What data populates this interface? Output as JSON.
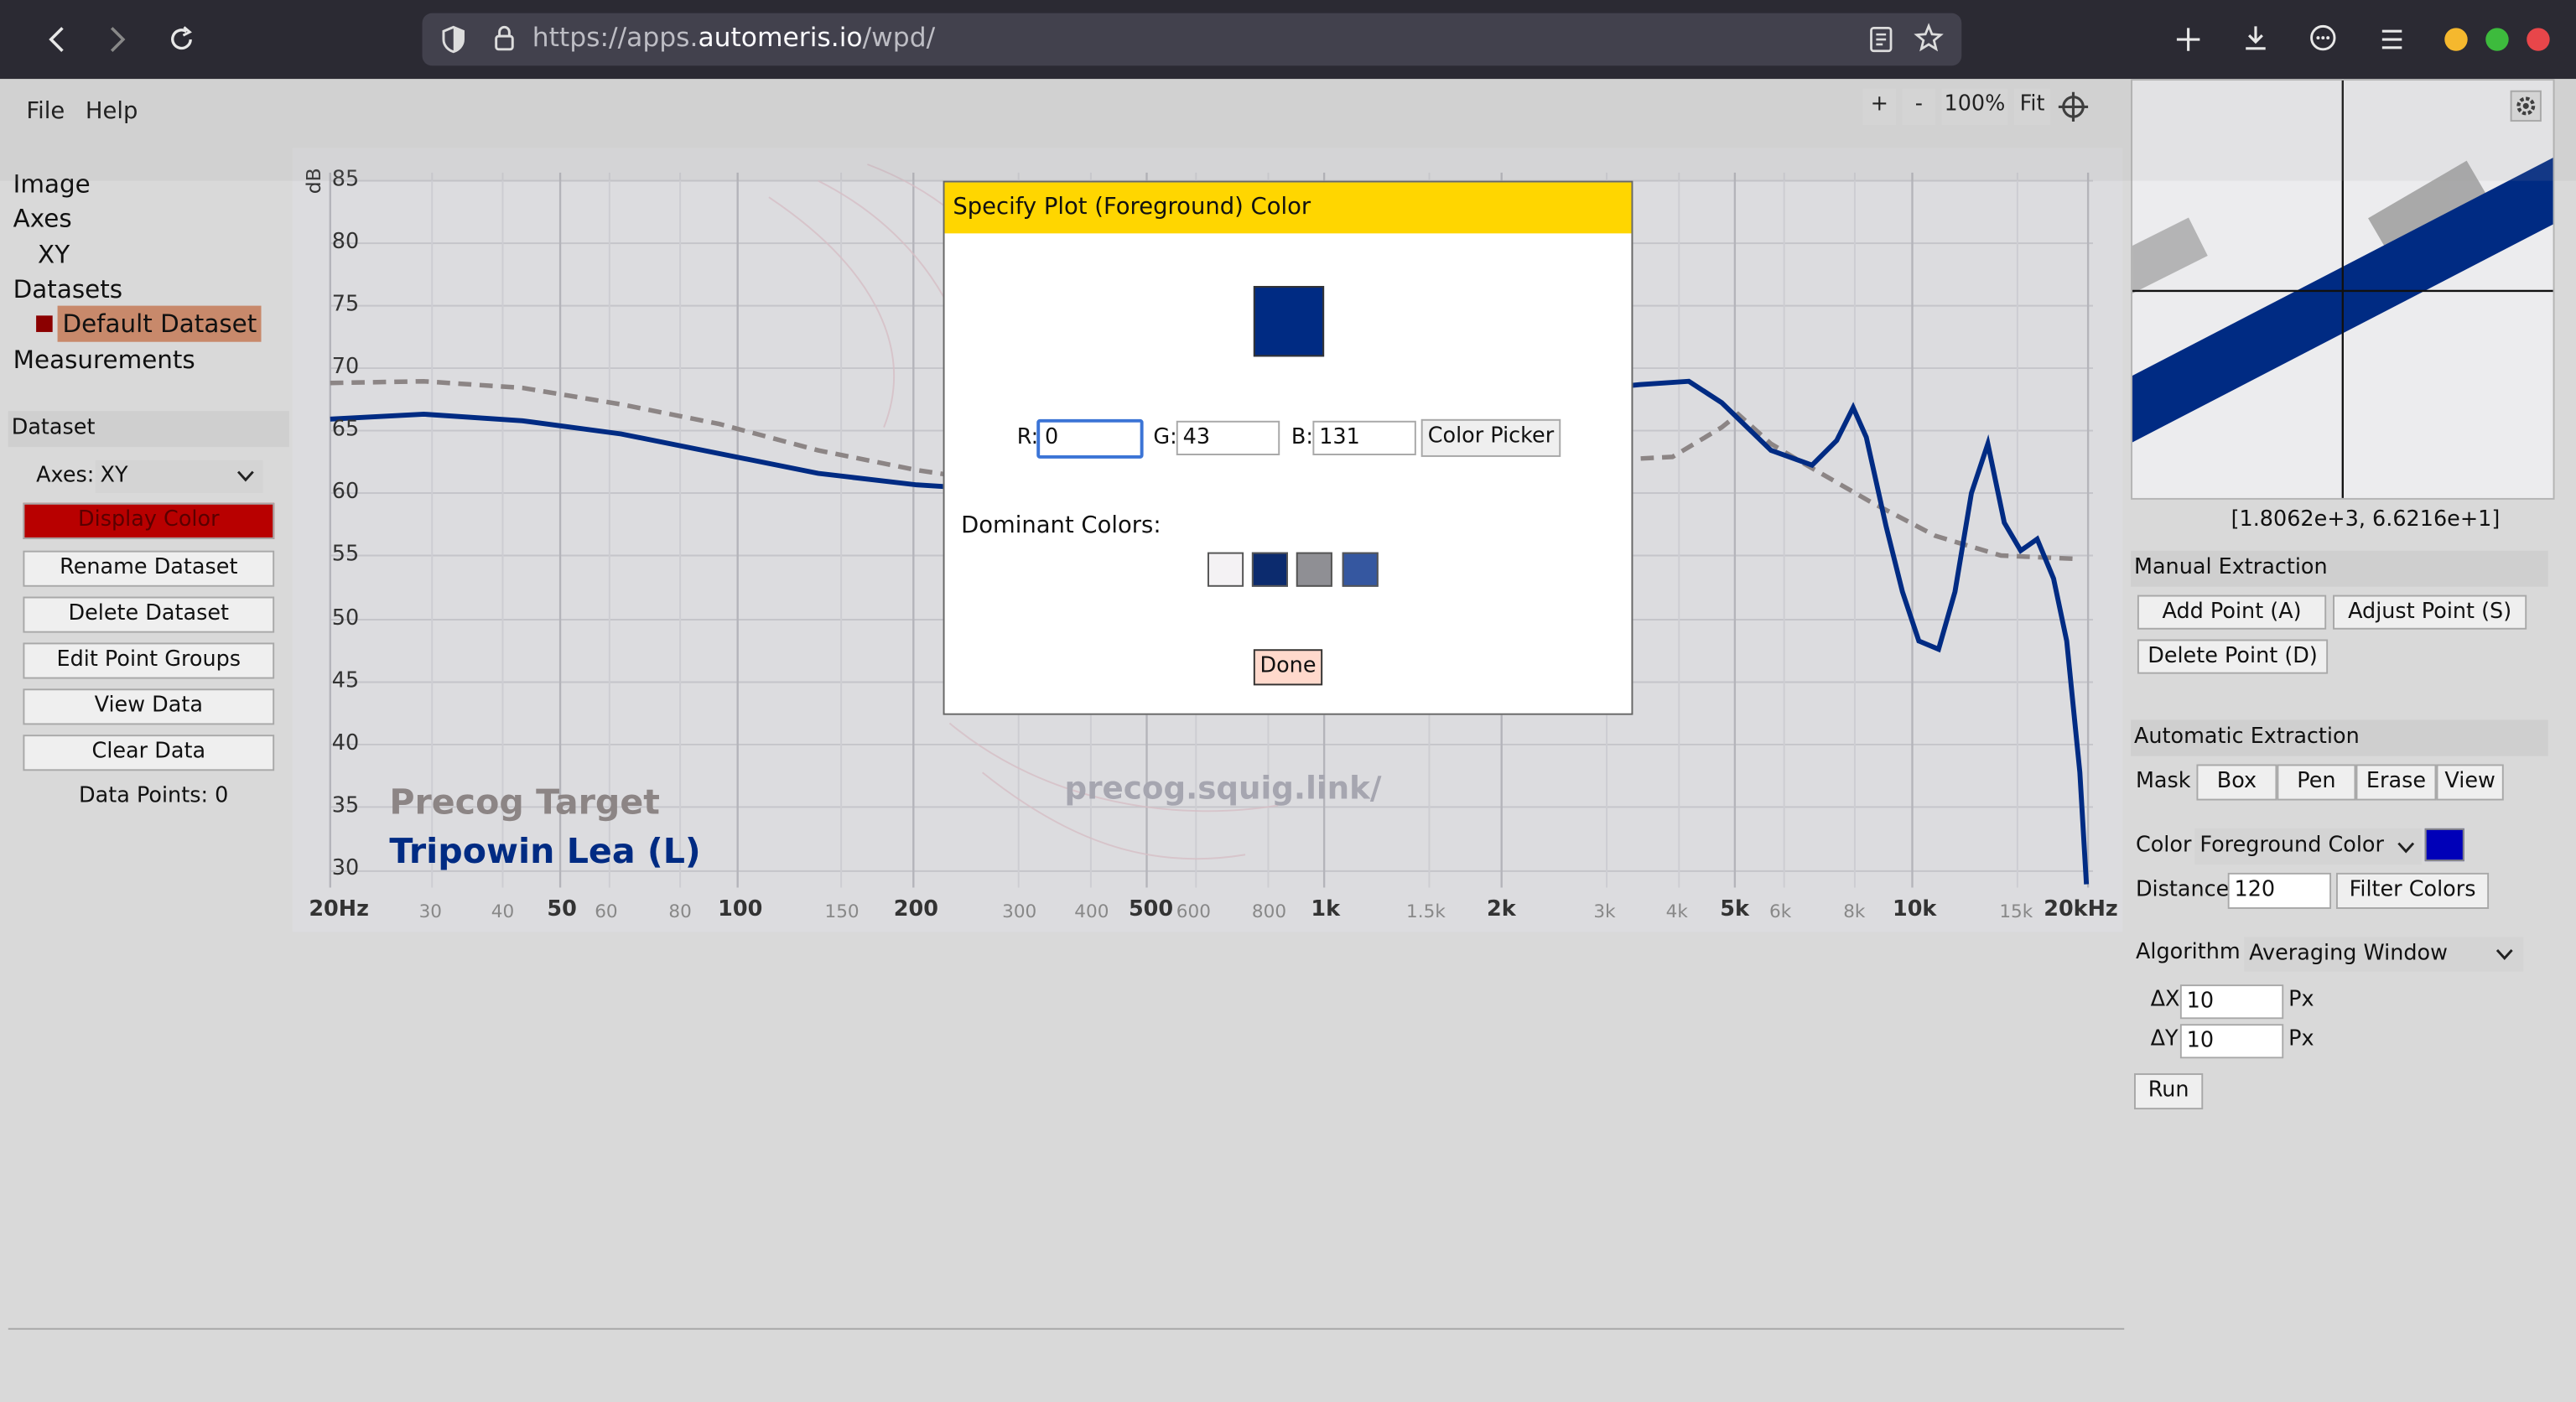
{
  "browser": {
    "url_prefix": "https://apps.",
    "url_domain": "automeris.io",
    "url_path": "/wpd/",
    "icons": [
      "back-arrow-icon",
      "forward-arrow-icon",
      "reload-icon",
      "shield-icon",
      "lock-icon",
      "reader-icon",
      "star-icon",
      "plus-icon",
      "download-icon",
      "extensions-icon",
      "menu-icon"
    ],
    "traffic_lights": [
      "#f5b82e",
      "#3dbb3d",
      "#e8464a"
    ]
  },
  "menu": {
    "file": "File",
    "help": "Help"
  },
  "zoom": {
    "plus": "+",
    "minus": "-",
    "level": "100%",
    "fit": "Fit"
  },
  "tree": {
    "image": "Image",
    "axes": "Axes",
    "xy": "XY",
    "datasets": "Datasets",
    "default_dataset": "Default Dataset",
    "measurements": "Measurements"
  },
  "dataset_panel": {
    "header": "Dataset",
    "axes_label": "Axes:",
    "axes_value": "XY",
    "display_color": "Display Color",
    "rename": "Rename Dataset",
    "delete": "Delete Dataset",
    "edit_groups": "Edit Point Groups",
    "view_data": "View Data",
    "clear_data": "Clear Data",
    "data_points": "Data Points: 0"
  },
  "plot": {
    "y_unit": "dB",
    "y_ticks": [
      "85",
      "80",
      "75",
      "70",
      "65",
      "60",
      "55",
      "50",
      "45",
      "40",
      "35",
      "30"
    ],
    "x_ticks": [
      "20Hz",
      "30",
      "40",
      "50",
      "60",
      "80",
      "100",
      "150",
      "200",
      "300",
      "400",
      "500",
      "600",
      "800",
      "1k",
      "1.5k",
      "2k",
      "3k",
      "4k",
      "5k",
      "6k",
      "8k",
      "10k",
      "15k",
      "20kHz"
    ],
    "legend_target": "Precog Target",
    "legend_iem": "Tripowin Lea (L)",
    "watermark": "precog.squig.link/",
    "target_color": "#8c8585",
    "iem_color": "#002b83"
  },
  "modal": {
    "title": "Specify Plot (Foreground) Color",
    "preview_color": "#002b83",
    "r_label": "R:",
    "r_value": "0",
    "g_label": "G:",
    "g_value": "43",
    "b_label": "B:",
    "b_value": "131",
    "color_picker": "Color Picker",
    "dominant_label": "Dominant Colors:",
    "dominant_colors": [
      "#f4f2f4",
      "#0c2b6e",
      "#8f8f94",
      "#3557a0"
    ],
    "done": "Done"
  },
  "right_panel": {
    "coords": "[1.8062e+3, 6.6216e+1]",
    "manual_header": "Manual Extraction",
    "add_point": "Add Point (A)",
    "adjust_point": "Adjust Point (S)",
    "delete_point": "Delete Point (D)",
    "auto_header": "Automatic Extraction",
    "mask_label": "Mask",
    "mask_box": "Box",
    "mask_pen": "Pen",
    "mask_erase": "Erase",
    "mask_view": "View",
    "color_label": "Color",
    "color_value": "Foreground Color",
    "color_swatch": "#0000b8",
    "distance_label": "Distance",
    "distance_value": "120",
    "filter_colors": "Filter Colors",
    "algorithm_label": "Algorithm",
    "algorithm_value": "Averaging Window",
    "dx_label": "ΔX",
    "dx_value": "10",
    "dy_label": "ΔY",
    "dy_value": "10",
    "px": "Px",
    "run": "Run"
  }
}
